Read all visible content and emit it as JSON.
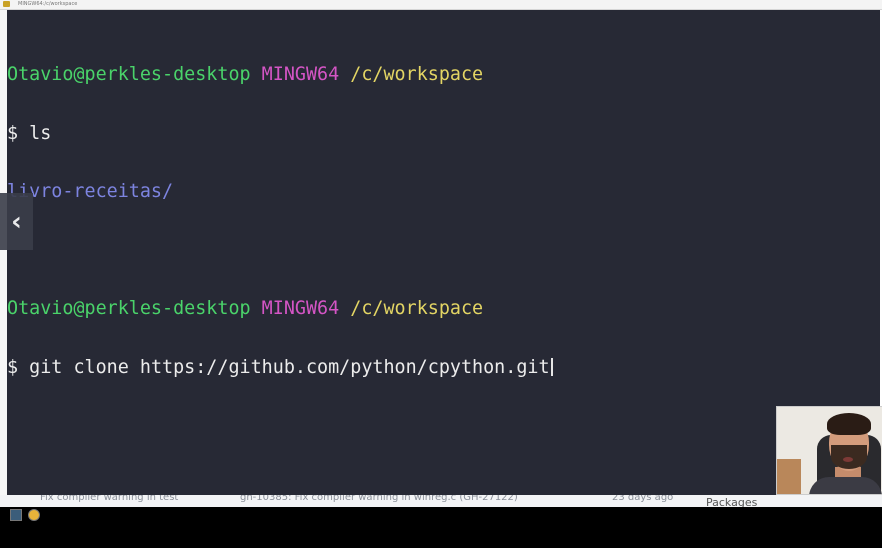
{
  "window": {
    "title": "MINGW64:/c/workspace",
    "app_icon": "git-bash-icon"
  },
  "terminal": {
    "lines": [
      {
        "user": "Otavio@perkles-desktop",
        "system": "MINGW64",
        "path": "/c/workspace"
      },
      {
        "prompt": "$",
        "command": "ls"
      },
      {
        "output": "livro-receitas/"
      },
      {
        "blank": ""
      },
      {
        "user": "Otavio@perkles-desktop",
        "system": "MINGW64",
        "path": "/c/workspace"
      },
      {
        "prompt": "$",
        "command": "git clone https://github.com/python/cpython.git"
      }
    ]
  },
  "nav": {
    "prev_icon": "chevron-left-icon",
    "prev_glyph": "‹"
  },
  "background_page": {
    "row_fragments": [
      {
        "text": "Fix compiler warning in test"
      },
      {
        "text": "gh-10385: Fix compiler warning in winreg.c (GH-27122)"
      },
      {
        "text": "23 days ago"
      }
    ],
    "packages_label": "Packages"
  },
  "colors": {
    "terminal_bg": "#272935",
    "user": "#4ad36a",
    "system": "#d455c5",
    "path": "#e3d564",
    "directory": "#7d84e0",
    "text": "#ececec"
  }
}
